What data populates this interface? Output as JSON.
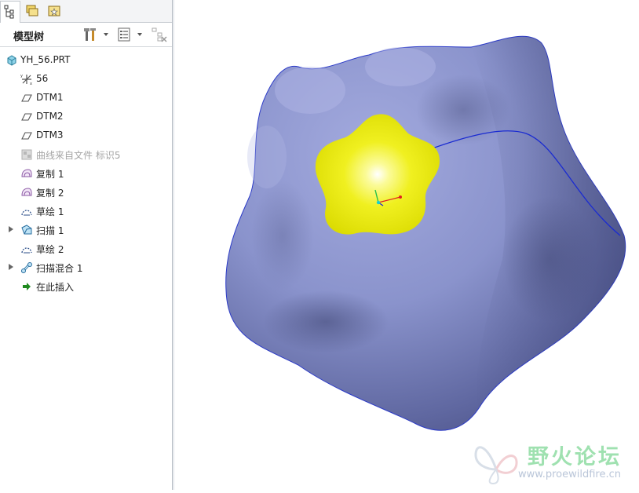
{
  "model_tree": {
    "title": "模型树",
    "items": [
      {
        "label": "YH_56.PRT",
        "icon": "part-icon",
        "expandable": false,
        "disabled": false
      },
      {
        "label": "56",
        "icon": "coordinate-system-icon",
        "expandable": false,
        "disabled": false
      },
      {
        "label": "DTM1",
        "icon": "datum-plane-icon",
        "expandable": false,
        "disabled": false
      },
      {
        "label": "DTM2",
        "icon": "datum-plane-icon",
        "expandable": false,
        "disabled": false
      },
      {
        "label": "DTM3",
        "icon": "datum-plane-icon",
        "expandable": false,
        "disabled": false
      },
      {
        "label": "曲线来自文件 标识5",
        "icon": "curve-from-file-icon",
        "expandable": false,
        "disabled": true
      },
      {
        "label": "复制 1",
        "icon": "copy-surface-icon",
        "expandable": false,
        "disabled": false
      },
      {
        "label": "复制 2",
        "icon": "copy-surface-icon",
        "expandable": false,
        "disabled": false
      },
      {
        "label": "草绘 1",
        "icon": "sketch-icon",
        "expandable": false,
        "disabled": false
      },
      {
        "label": "扫描 1",
        "icon": "sweep-icon",
        "expandable": true,
        "disabled": false
      },
      {
        "label": "草绘 2",
        "icon": "sketch-icon",
        "expandable": false,
        "disabled": false
      },
      {
        "label": "扫描混合 1",
        "icon": "swept-blend-icon",
        "expandable": true,
        "disabled": false
      },
      {
        "label": "在此插入",
        "icon": "insert-here-arrow-icon",
        "expandable": false,
        "disabled": false
      }
    ]
  },
  "watermark": {
    "title": "野火论坛",
    "url": "www.proewildfire.cn"
  },
  "colors": {
    "model_surface": "#8a93cc",
    "highlight_face": "#e6e600",
    "edge_curve": "#1a2bd1",
    "insert_arrow": "#1f8a1f"
  }
}
